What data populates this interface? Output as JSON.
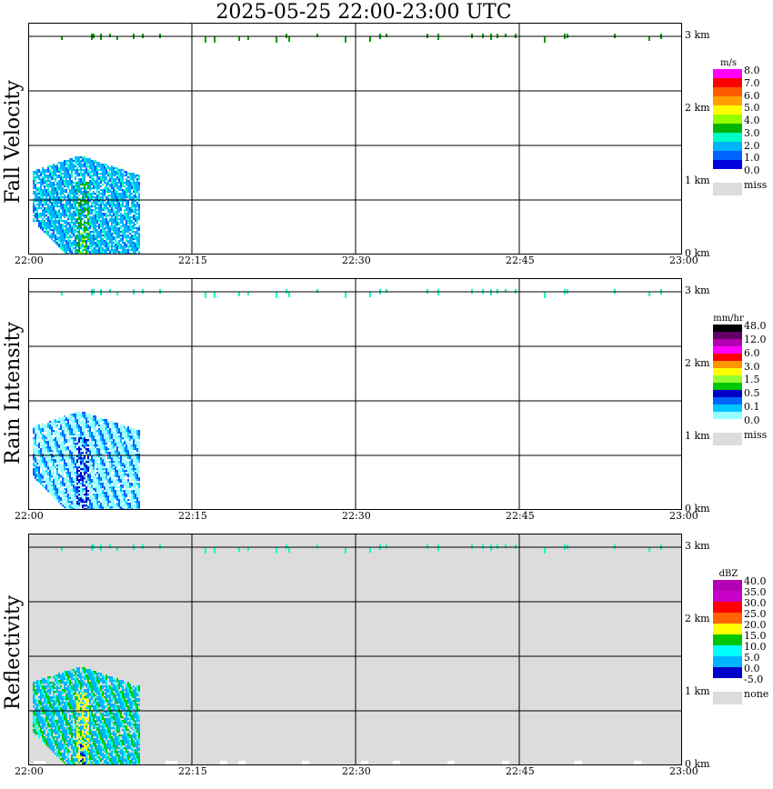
{
  "title": "2025-05-25  22:00-23:00 UTC",
  "time_ticks": [
    "22:00",
    "22:15",
    "22:30",
    "22:45",
    "23:00"
  ],
  "alt_ticks": [
    "0 km",
    "1 km",
    "2 km",
    "3 km"
  ],
  "panels": [
    {
      "ylabel": "Fall Velocity",
      "unit": "m/s",
      "background": "#ffffff",
      "colorbar": [
        {
          "color": "#ff00ff",
          "label": "8.0"
        },
        {
          "color": "#ff0000",
          "label": "7.0"
        },
        {
          "color": "#ff5a00",
          "label": "6.0"
        },
        {
          "color": "#ffa000",
          "label": "5.0"
        },
        {
          "color": "#ffff00",
          "label": "4.0"
        },
        {
          "color": "#96ff00",
          "label": "3.0"
        },
        {
          "color": "#00b400",
          "label": ""
        },
        {
          "color": "#00ffc8",
          "label": ""
        },
        {
          "color": "#00b4ff",
          "label": ""
        },
        {
          "color": "#0064ff",
          "label": ""
        },
        {
          "color": "#0000dc",
          "label": ""
        }
      ],
      "miss_label": "miss",
      "labels": [
        "8.0",
        "7.0",
        "6.0",
        "5.0",
        "4.0",
        "3.0",
        "2.0",
        "1.0",
        "0.0"
      ]
    },
    {
      "ylabel": "Rain Intensity",
      "unit": "mm/hr",
      "background": "#ffffff",
      "colorbar": [
        {
          "color": "#000000",
          "label": "48.0"
        },
        {
          "color": "#640064",
          "label": ""
        },
        {
          "color": "#b400b4",
          "label": "12.0"
        },
        {
          "color": "#ff00ff",
          "label": ""
        },
        {
          "color": "#ff0000",
          "label": "6.0"
        },
        {
          "color": "#ff9600",
          "label": ""
        },
        {
          "color": "#ffff00",
          "label": "3.0"
        },
        {
          "color": "#96ff32",
          "label": ""
        },
        {
          "color": "#00c800",
          "label": "1.5"
        },
        {
          "color": "#0000c8",
          "label": ""
        },
        {
          "color": "#0064ff",
          "label": "0.5"
        },
        {
          "color": "#00c8ff",
          "label": ""
        },
        {
          "color": "#96ffff",
          "label": "0.1"
        }
      ],
      "miss_label": "miss",
      "labels": [
        "48.0",
        "12.0",
        "6.0",
        "3.0",
        "1.5",
        "0.5",
        "0.1",
        "0.0"
      ]
    },
    {
      "ylabel": "Reflectivity",
      "unit": "dBZ",
      "background": "#dcdcdc",
      "colorbar": [
        {
          "color": "#b400b4",
          "label": "40.0"
        },
        {
          "color": "#c800c8",
          "label": "35.0"
        },
        {
          "color": "#ff0000",
          "label": "30.0"
        },
        {
          "color": "#ff6400",
          "label": "25.0"
        },
        {
          "color": "#ffff00",
          "label": "20.0"
        },
        {
          "color": "#00c800",
          "label": "15.0"
        },
        {
          "color": "#00ffff",
          "label": "10.0"
        },
        {
          "color": "#00b4ff",
          "label": "5.0"
        },
        {
          "color": "#0000c8",
          "label": "0.0"
        }
      ],
      "miss_label": "none",
      "labels": [
        "40.0",
        "35.0",
        "30.0",
        "25.0",
        "20.0",
        "15.0",
        "10.0",
        "5.0",
        "0.0",
        "-5.0"
      ]
    }
  ],
  "chart_data": [
    {
      "type": "heatmap",
      "title": "2025-05-25  22:00-23:00 UTC",
      "ylabel": "Fall Velocity",
      "x_range": [
        "22:00",
        "23:00"
      ],
      "y_range_km": [
        0,
        3.2
      ],
      "colorbar_unit": "m/s",
      "colorbar_range": [
        0.0,
        8.0
      ],
      "precip_echo_time_range": [
        "22:00",
        "22:10"
      ],
      "precip_echo_max_height_km": 1.4,
      "cloud_echo_height_km": 3.0
    },
    {
      "type": "heatmap",
      "title": "2025-05-25  22:00-23:00 UTC",
      "ylabel": "Rain Intensity",
      "x_range": [
        "22:00",
        "23:00"
      ],
      "y_range_km": [
        0,
        3.2
      ],
      "colorbar_unit": "mm/hr",
      "colorbar_range": [
        0.0,
        48.0
      ],
      "precip_echo_time_range": [
        "22:00",
        "22:10"
      ],
      "precip_echo_max_height_km": 1.4,
      "cloud_echo_height_km": 3.0
    },
    {
      "type": "heatmap",
      "title": "2025-05-25  22:00-23:00 UTC",
      "ylabel": "Reflectivity",
      "x_range": [
        "22:00",
        "23:00"
      ],
      "y_range_km": [
        0,
        3.2
      ],
      "colorbar_unit": "dBZ",
      "colorbar_range": [
        -5.0,
        40.0
      ],
      "precip_echo_time_range": [
        "22:00",
        "22:10"
      ],
      "precip_echo_max_height_km": 1.4,
      "cloud_echo_height_km": 3.0
    }
  ]
}
